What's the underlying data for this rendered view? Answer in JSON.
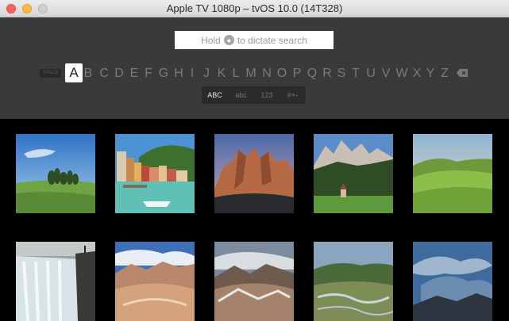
{
  "window": {
    "title": "Apple TV 1080p – tvOS 10.0 (14T328)"
  },
  "search": {
    "placeholder_before": "Hold",
    "placeholder_after": "to dictate search",
    "mic_icon": "microphone-icon"
  },
  "keyboard": {
    "space_label": "SPACE",
    "letters": [
      "A",
      "B",
      "C",
      "D",
      "E",
      "F",
      "G",
      "H",
      "I",
      "J",
      "K",
      "L",
      "M",
      "N",
      "O",
      "P",
      "Q",
      "R",
      "S",
      "T",
      "U",
      "V",
      "W",
      "X",
      "Y",
      "Z"
    ],
    "selected": "A",
    "delete_icon": "backspace-icon",
    "modes": [
      "ABC",
      "abc",
      "123",
      "#+-"
    ],
    "active_mode": "ABC"
  },
  "results": {
    "row1": [
      "tree-field-photo",
      "coastal-village-photo",
      "rocky-peaks-sunset-photo",
      "alpine-chapel-photo",
      "green-hills-photo"
    ],
    "row2": [
      "waterfall-photo",
      "desert-rocks-photo",
      "volcanic-mountains-photo",
      "river-valley-photo",
      "storm-clouds-photo"
    ]
  },
  "colors": {
    "search_bg": "#3a3a3a",
    "results_bg": "#000000",
    "close": "#fc615d",
    "minimize": "#fdbc40"
  }
}
